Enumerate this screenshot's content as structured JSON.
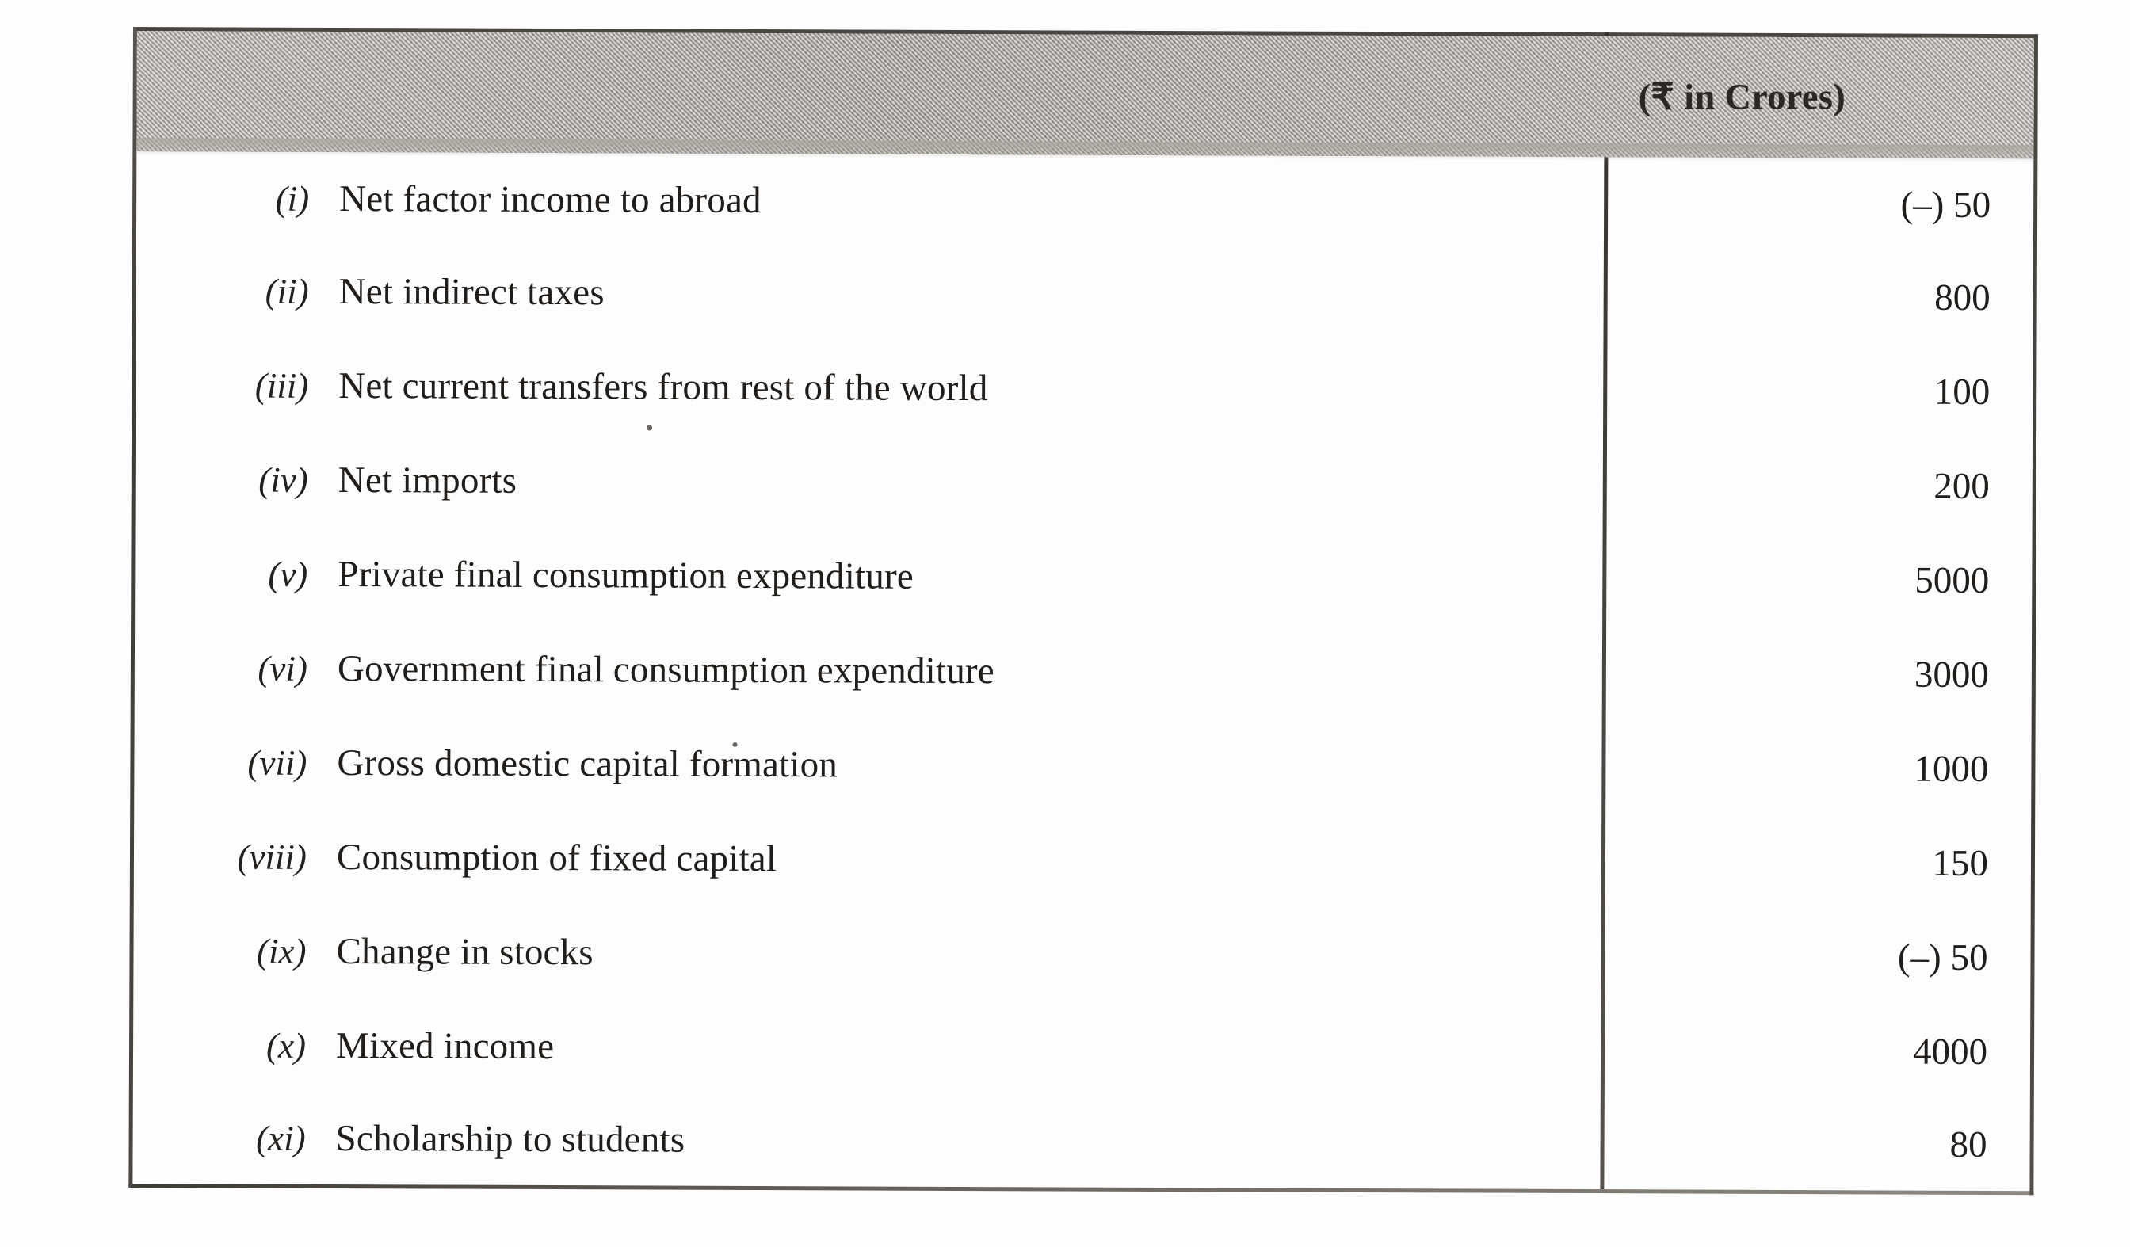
{
  "table": {
    "header": {
      "description_column_label": "",
      "unit_column_label": "(₹ in Crores)"
    },
    "rows": [
      {
        "numeral": "(i)",
        "label": "Net factor income to abroad",
        "value": "(–) 50"
      },
      {
        "numeral": "(ii)",
        "label": "Net indirect taxes",
        "value": "800"
      },
      {
        "numeral": "(iii)",
        "label": "Net current transfers from rest of the world",
        "value": "100"
      },
      {
        "numeral": "(iv)",
        "label": "Net imports",
        "value": "200"
      },
      {
        "numeral": "(v)",
        "label": "Private final consumption expenditure",
        "value": "5000"
      },
      {
        "numeral": "(vi)",
        "label": "Government final consumption expenditure",
        "value": "3000"
      },
      {
        "numeral": "(vii)",
        "label": "Gross domestic capital formation",
        "value": "1000"
      },
      {
        "numeral": "(viii)",
        "label": "Consumption of fixed capital",
        "value": "150"
      },
      {
        "numeral": "(ix)",
        "label": "Change in stocks",
        "value": "(–) 50"
      },
      {
        "numeral": "(x)",
        "label": "Mixed income",
        "value": "4000"
      },
      {
        "numeral": "(xi)",
        "label": "Scholarship to students",
        "value": "80"
      }
    ]
  },
  "colors": {
    "header_band": "#a9a49e",
    "border": "#4a4642",
    "text": "#201d1a",
    "page_background": "#ffffff"
  }
}
